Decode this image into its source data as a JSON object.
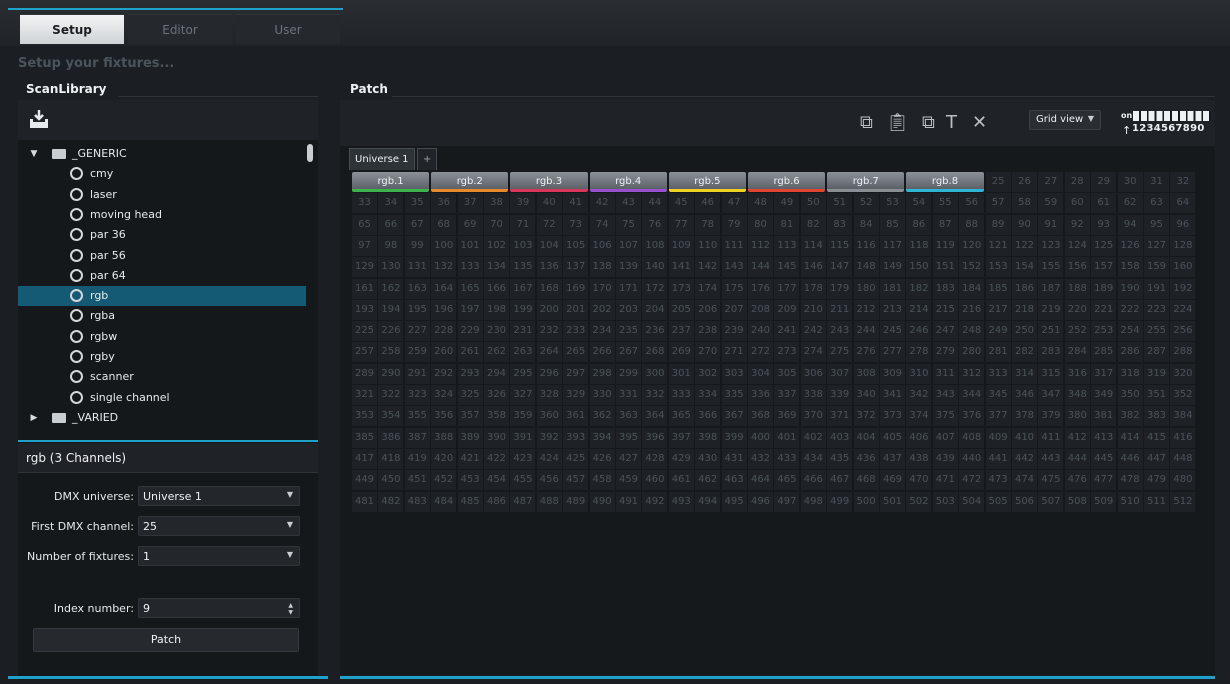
{
  "tabs": [
    "Setup",
    "Editor",
    "User"
  ],
  "subtitle": "Setup your fixtures...",
  "scan_library": {
    "title": "ScanLibrary",
    "tree": [
      {
        "label": "_GENERIC",
        "type": "folder",
        "expanded": true,
        "level": 0
      },
      {
        "label": "cmy",
        "type": "fixture",
        "level": 1
      },
      {
        "label": "laser",
        "type": "fixture",
        "level": 1
      },
      {
        "label": "moving head",
        "type": "fixture",
        "level": 1
      },
      {
        "label": "par 36",
        "type": "fixture",
        "level": 1
      },
      {
        "label": "par 56",
        "type": "fixture",
        "level": 1
      },
      {
        "label": "par 64",
        "type": "fixture",
        "level": 1
      },
      {
        "label": "rgb",
        "type": "fixture",
        "level": 1,
        "selected": true
      },
      {
        "label": "rgba",
        "type": "fixture",
        "level": 1
      },
      {
        "label": "rgbw",
        "type": "fixture",
        "level": 1
      },
      {
        "label": "rgby",
        "type": "fixture",
        "level": 1
      },
      {
        "label": "scanner",
        "type": "fixture",
        "level": 1
      },
      {
        "label": "single channel",
        "type": "fixture",
        "level": 1
      },
      {
        "label": "_VARIED",
        "type": "folder",
        "expanded": false,
        "level": 0
      }
    ],
    "fixture_info": "rgb (3 Channels)",
    "form": {
      "dmx_universe_label": "DMX universe:",
      "dmx_universe_value": "Universe 1",
      "first_channel_label": "First DMX channel:",
      "first_channel_value": "25",
      "num_fixtures_label": "Number of fixtures:",
      "num_fixtures_value": "1",
      "index_label": "Index number:",
      "index_value": "9",
      "patch_button": "Patch"
    }
  },
  "patch": {
    "title": "Patch",
    "view_mode": "Grid view",
    "legend_on": "on",
    "legend_digits": "1234567890",
    "universe_tabs": [
      "Universe 1",
      "+"
    ],
    "total_channels": 512,
    "columns": 32,
    "fixtures": [
      {
        "label": "rgb.1",
        "start": 1,
        "channels": 3,
        "color": "#3bb54a"
      },
      {
        "label": "rgb.2",
        "start": 4,
        "channels": 3,
        "color": "#e8892b"
      },
      {
        "label": "rgb.3",
        "start": 7,
        "channels": 3,
        "color": "#d9365e"
      },
      {
        "label": "rgb.4",
        "start": 10,
        "channels": 3,
        "color": "#9a4fd1"
      },
      {
        "label": "rgb.5",
        "start": 13,
        "channels": 3,
        "color": "#f0d020"
      },
      {
        "label": "rgb.6",
        "start": 16,
        "channels": 3,
        "color": "#e0462f"
      },
      {
        "label": "rgb.7",
        "start": 19,
        "channels": 3,
        "color": "#8a8f94"
      },
      {
        "label": "rgb.8",
        "start": 22,
        "channels": 3,
        "color": "#2fb4d8"
      }
    ]
  },
  "colors": {
    "accent": "#1fa1c9",
    "selection": "#155a74"
  }
}
